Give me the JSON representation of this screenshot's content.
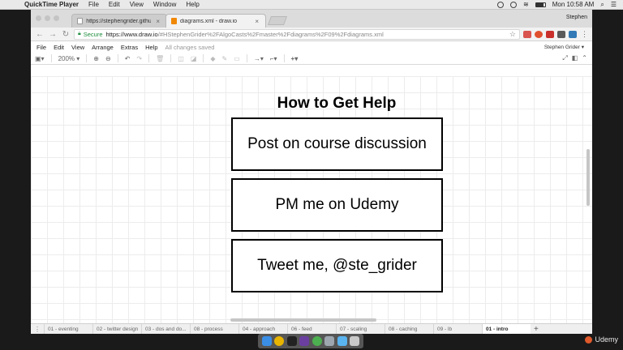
{
  "menubar": {
    "apple_icon": "apple-icon",
    "items": [
      "QuickTime Player",
      "File",
      "Edit",
      "View",
      "Window",
      "Help"
    ],
    "clock": "Mon 10:58 AM"
  },
  "browser": {
    "tabs": [
      {
        "label": "https://stephengrider.github.io",
        "active": false
      },
      {
        "label": "diagrams.xml - draw.io",
        "active": true
      }
    ],
    "profile": "Stephen",
    "secure_label": "Secure",
    "url_host": "https://www.draw.io",
    "url_rest": "/#HStephenGrider%2FAlgoCasts%2Fmaster%2Fdiagrams%2F09%2Fdiagrams.xml"
  },
  "drawio": {
    "menu": [
      "File",
      "Edit",
      "View",
      "Arrange",
      "Extras",
      "Help"
    ],
    "status": "All changes saved",
    "user": "Stephen Grider",
    "zoom": "200%"
  },
  "diagram": {
    "title": "How to Get Help",
    "boxes": [
      "Post on course discussion",
      "PM me on Udemy",
      "Tweet me, @ste_grider"
    ]
  },
  "pages": [
    {
      "label": "01 - eventing",
      "active": false
    },
    {
      "label": "02 - twitter design",
      "active": false
    },
    {
      "label": "03 - dos and do...",
      "active": false
    },
    {
      "label": "08 - process",
      "active": false
    },
    {
      "label": "04 - approach",
      "active": false
    },
    {
      "label": "06 - feed",
      "active": false
    },
    {
      "label": "07 - scaling",
      "active": false
    },
    {
      "label": "08 - caching",
      "active": false
    },
    {
      "label": "09 - lb",
      "active": false
    },
    {
      "label": "01 - intro",
      "active": true
    }
  ],
  "watermark": "Udemy",
  "colors": {
    "secure": "#1e8e3e",
    "udemy": "#e05a2b"
  }
}
